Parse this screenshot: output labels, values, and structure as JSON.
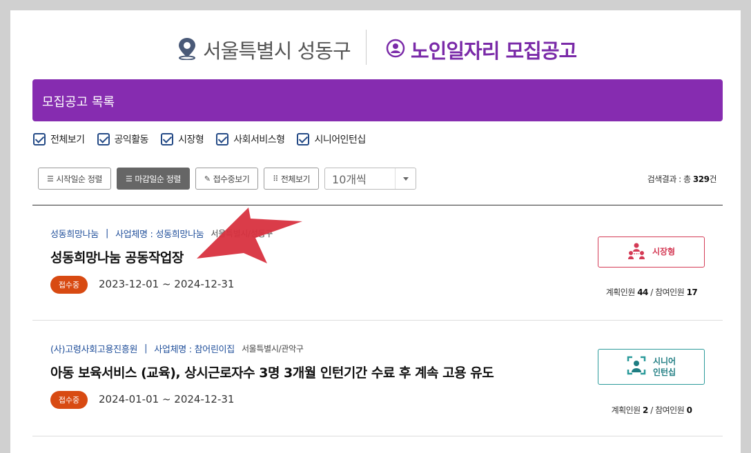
{
  "header": {
    "location": "서울특별시 성동구",
    "service_title": "노인일자리 모집공고",
    "location_icon": "map-pin-icon",
    "service_icon": "user-circle-icon"
  },
  "list": {
    "title": "모집공고 목록"
  },
  "filters": [
    {
      "label": "전체보기",
      "checked": true
    },
    {
      "label": "공익활동",
      "checked": true
    },
    {
      "label": "시장형",
      "checked": true
    },
    {
      "label": "사회서비스형",
      "checked": true
    },
    {
      "label": "시니어인턴십",
      "checked": true
    }
  ],
  "toolbar": {
    "sort_start": "시작일순 정렬",
    "sort_deadline": "마감일순 정렬",
    "accepting": "접수중보기",
    "view_all": "전체보기",
    "page_size": "10개씩",
    "result_prefix": "검색결과 : 총 ",
    "result_count": "329",
    "result_suffix": "건"
  },
  "items": [
    {
      "org": "성동희망나눔",
      "biz_label": "사업체명 : 성동희망나눔",
      "region": "서울특별시/성동구",
      "title": "성동희망나눔 공동작업장",
      "status": "접수중",
      "period": "2023-12-01 ~ 2024-12-31",
      "type": "시장형",
      "type_icon": "group-people-icon",
      "counts_plan_label": "계획인원 ",
      "plan": "44",
      "counts_sep": " / 참여인원 ",
      "join": "17"
    },
    {
      "org": "(사)고령사회고용진흥원",
      "biz_label": "사업체명 : 참어린이집",
      "region": "서울특별시/관악구",
      "title": "아동 보육서비스 (교육), 상시근로자수 3명 3개월 인턴기간 수료 후 계속 고용 유도",
      "status": "접수중",
      "period": "2024-01-01 ~ 2024-12-31",
      "type_line1": "시니어",
      "type_line2": "인턴십",
      "type_icon": "senior-intern-icon",
      "counts_plan_label": "계획인원 ",
      "plan": "2",
      "counts_sep": " / 참여인원 ",
      "join": "0"
    }
  ],
  "colors": {
    "brand_purple": "#862cb0",
    "status_orange": "#d84a12",
    "market_red": "#d43a55",
    "intern_teal": "#2a9a9a",
    "annotation_arrow": "#d8323f"
  }
}
